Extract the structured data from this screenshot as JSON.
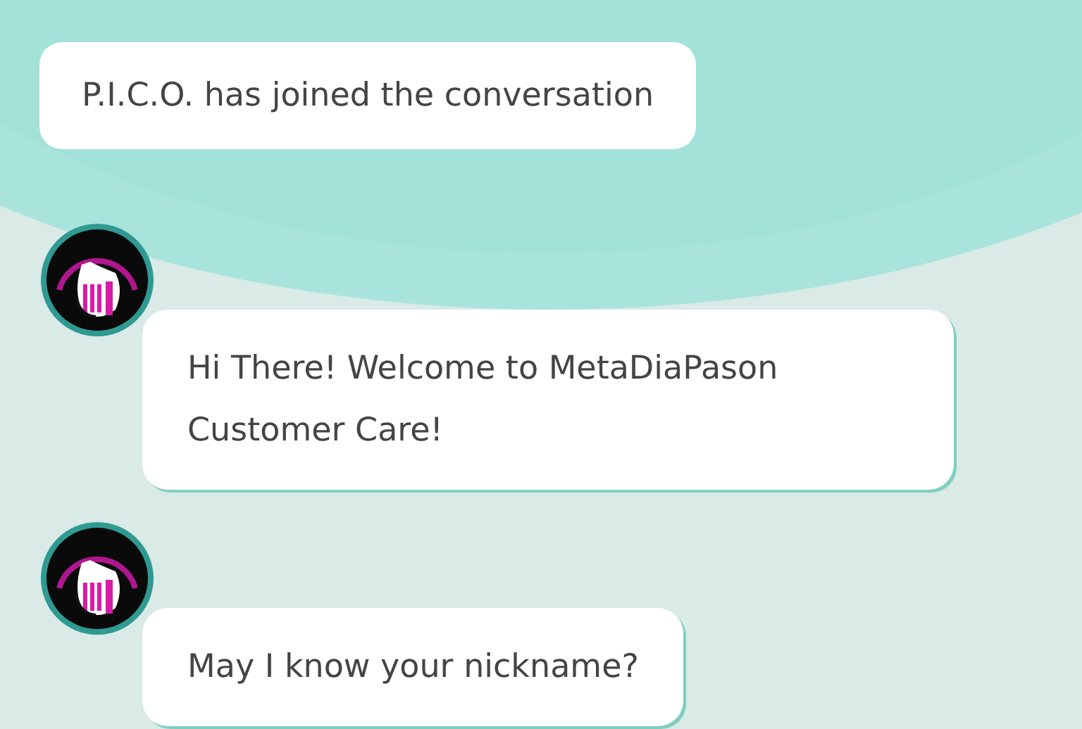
{
  "messages": [
    {
      "kind": "system",
      "text": "P.I.C.O. has joined the conversation"
    },
    {
      "kind": "bot",
      "text": "Hi There! Welcome to MetaDiaPason Customer Care!"
    },
    {
      "kind": "bot",
      "text": "May I know your nickname?"
    }
  ]
}
